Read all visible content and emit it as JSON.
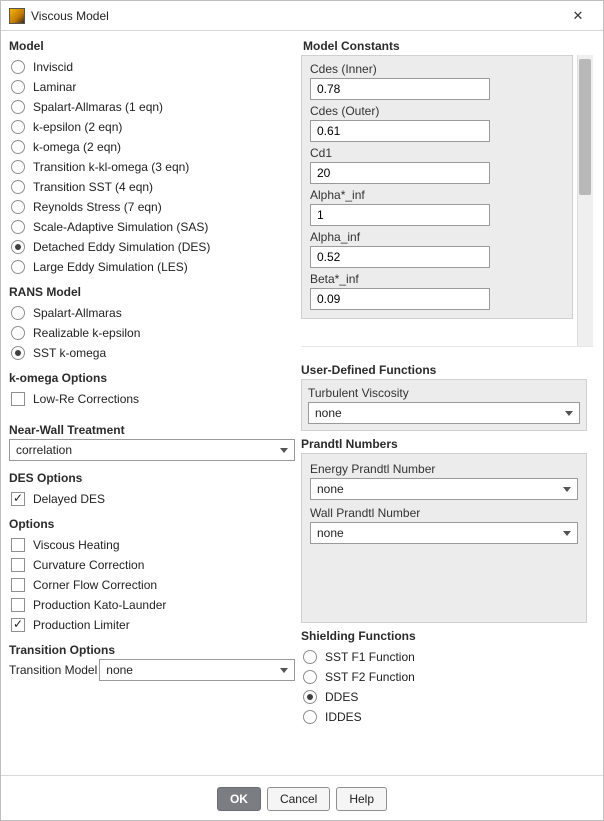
{
  "window": {
    "title": "Viscous Model"
  },
  "headings": {
    "model": "Model",
    "rans_model": "RANS Model",
    "k_omega_options": "k-omega Options",
    "near_wall": "Near-Wall Treatment",
    "des_options": "DES Options",
    "options": "Options",
    "transition_options": "Transition Options",
    "model_constants": "Model Constants",
    "udf": "User-Defined Functions",
    "prandtl_numbers": "Prandtl Numbers",
    "shielding_functions": "Shielding Functions"
  },
  "model": {
    "items": [
      {
        "label": "Inviscid",
        "selected": false
      },
      {
        "label": "Laminar",
        "selected": false
      },
      {
        "label": "Spalart-Allmaras (1 eqn)",
        "selected": false
      },
      {
        "label": "k-epsilon (2 eqn)",
        "selected": false
      },
      {
        "label": "k-omega (2 eqn)",
        "selected": false
      },
      {
        "label": "Transition k-kl-omega (3 eqn)",
        "selected": false
      },
      {
        "label": "Transition SST (4 eqn)",
        "selected": false
      },
      {
        "label": "Reynolds Stress (7 eqn)",
        "selected": false
      },
      {
        "label": "Scale-Adaptive Simulation (SAS)",
        "selected": false
      },
      {
        "label": "Detached Eddy Simulation (DES)",
        "selected": true
      },
      {
        "label": "Large Eddy Simulation (LES)",
        "selected": false
      }
    ]
  },
  "rans_model": {
    "items": [
      {
        "label": "Spalart-Allmaras",
        "selected": false
      },
      {
        "label": "Realizable k-epsilon",
        "selected": false
      },
      {
        "label": "SST k-omega",
        "selected": true
      }
    ]
  },
  "k_omega_options": {
    "items": [
      {
        "label": "Low-Re Corrections",
        "checked": false
      }
    ]
  },
  "near_wall": {
    "value": "correlation"
  },
  "des_options": {
    "items": [
      {
        "label": "Delayed DES",
        "checked": true
      }
    ]
  },
  "options": {
    "items": [
      {
        "label": "Viscous Heating",
        "checked": false
      },
      {
        "label": "Curvature Correction",
        "checked": false
      },
      {
        "label": "Corner Flow Correction",
        "checked": false
      },
      {
        "label": "Production Kato-Launder",
        "checked": false
      },
      {
        "label": "Production Limiter",
        "checked": true
      }
    ]
  },
  "transition": {
    "label": "Transition Model",
    "value": "none"
  },
  "constants": {
    "fields": [
      {
        "label": "Cdes (Inner)",
        "value": "0.78"
      },
      {
        "label": "Cdes (Outer)",
        "value": "0.61"
      },
      {
        "label": "Cd1",
        "value": "20"
      },
      {
        "label": "Alpha*_inf",
        "value": "1"
      },
      {
        "label": "Alpha_inf",
        "value": "0.52"
      },
      {
        "label": "Beta*_inf",
        "value": "0.09"
      }
    ]
  },
  "udf": {
    "turbulent_viscosity_label": "Turbulent Viscosity",
    "turbulent_viscosity_value": "none"
  },
  "prandtl": {
    "energy_label": "Energy Prandtl Number",
    "energy_value": "none",
    "wall_label": "Wall Prandtl Number",
    "wall_value": "none"
  },
  "shielding": {
    "items": [
      {
        "label": "SST F1 Function",
        "selected": false
      },
      {
        "label": "SST F2 Function",
        "selected": false
      },
      {
        "label": "DDES",
        "selected": true
      },
      {
        "label": "IDDES",
        "selected": false
      }
    ]
  },
  "footer": {
    "ok": "OK",
    "cancel": "Cancel",
    "help": "Help"
  }
}
